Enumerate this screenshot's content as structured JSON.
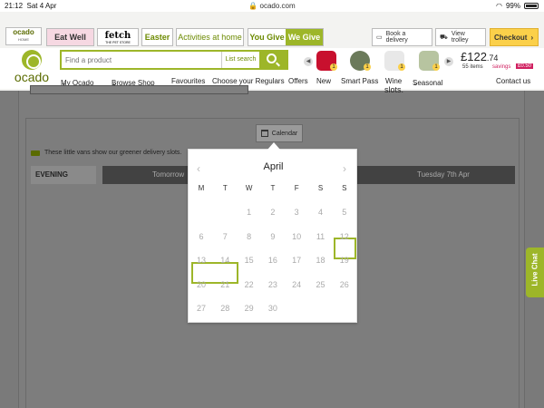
{
  "status": {
    "time": "21:12",
    "date": "Sat 4 Apr",
    "url": "ocado.com",
    "battery": "99%"
  },
  "tabs": {
    "ocado_home_word": "ocado",
    "ocado_home_sub": "HOME",
    "eat_well": "Eat Well",
    "fetch": "fetch",
    "fetch_sub": "THE PET STORE",
    "easter": "Easter",
    "activities": "Activities at home",
    "you_give": "You Give",
    "we_give": "We Give"
  },
  "actions": {
    "delivery": "Book a delivery",
    "trolley": "View trolley",
    "checkout": "Checkout"
  },
  "brand": {
    "name": "ocado",
    "color": "#9db629"
  },
  "search": {
    "placeholder": "Find a product",
    "list_search": "List search"
  },
  "trolley_badges": [
    "1",
    "1",
    "1",
    "1"
  ],
  "trolley": {
    "total_main": "£122",
    "total_pence": ".74",
    "items": "55 items",
    "savings_label": "savings",
    "savings_amount": "£0.50"
  },
  "menu": [
    "My Ocado",
    "Browse Shop",
    "Favourites",
    "Choose your Regulars",
    "Offers",
    "New",
    "Smart Pass",
    "Wine",
    "Seasonal",
    "Contact us"
  ],
  "page": {
    "slots_text": "slots.",
    "calendar_button": "Calendar",
    "vans_note": "These little vans show our greener delivery slots.",
    "evening": "EVENING",
    "day_tomorrow": "Tomorrow",
    "day_tuesday": "Tuesday 7th Apr"
  },
  "calendar": {
    "month": "April",
    "weekdays": [
      "M",
      "T",
      "W",
      "T",
      "F",
      "S",
      "S"
    ],
    "rows": [
      [
        "",
        "",
        "1",
        "2",
        "3",
        "4",
        "5"
      ],
      [
        "6",
        "7",
        "8",
        "9",
        "10",
        "11",
        "12"
      ],
      [
        "13",
        "14",
        "15",
        "16",
        "17",
        "18",
        "19"
      ],
      [
        "20",
        "21",
        "22",
        "23",
        "24",
        "25",
        "26"
      ],
      [
        "27",
        "28",
        "29",
        "30",
        "",
        "",
        ""
      ]
    ]
  },
  "live_chat": "Live Chat"
}
